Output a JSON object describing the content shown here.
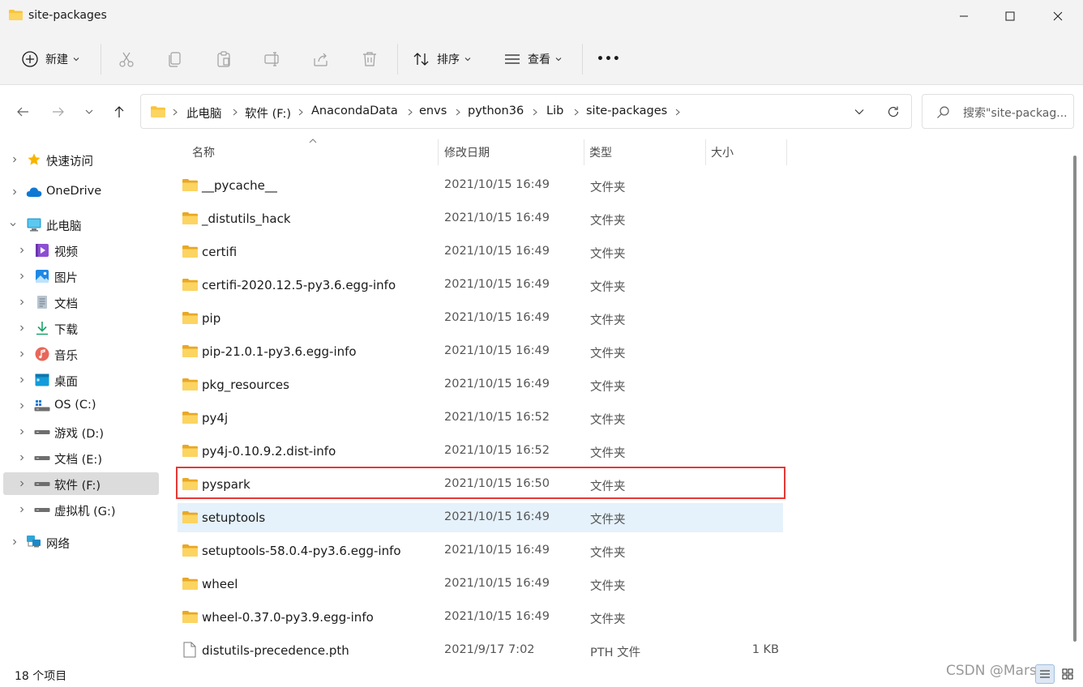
{
  "window": {
    "title": "site-packages"
  },
  "toolbar": {
    "new_label": "新建",
    "sort_label": "排序",
    "view_label": "查看",
    "more_label": "•••"
  },
  "breadcrumb": [
    "此电脑",
    "软件 (F:)",
    "AnacondaData",
    "envs",
    "python36",
    "Lib",
    "site-packages"
  ],
  "search": {
    "placeholder": "搜索\"site-packag..."
  },
  "sidebar": {
    "items": [
      {
        "label": "快速访问",
        "icon": "star-icon"
      },
      {
        "label": "OneDrive",
        "icon": "cloud-icon"
      },
      {
        "label": "此电脑",
        "icon": "computer-icon"
      },
      {
        "label": "视频",
        "icon": "video-icon"
      },
      {
        "label": "图片",
        "icon": "pictures-icon"
      },
      {
        "label": "文档",
        "icon": "documents-icon"
      },
      {
        "label": "下载",
        "icon": "download-icon"
      },
      {
        "label": "音乐",
        "icon": "music-icon"
      },
      {
        "label": "桌面",
        "icon": "desktop-icon"
      },
      {
        "label": "OS (C:)",
        "icon": "windows-drive-icon"
      },
      {
        "label": "游戏  (D:)",
        "icon": "drive-icon"
      },
      {
        "label": "文档 (E:)",
        "icon": "drive-icon"
      },
      {
        "label": "软件 (F:)",
        "icon": "drive-icon"
      },
      {
        "label": "虚拟机 (G:)",
        "icon": "drive-icon"
      },
      {
        "label": "网络",
        "icon": "network-icon"
      }
    ]
  },
  "columns": {
    "name": "名称",
    "date": "修改日期",
    "type": "类型",
    "size": "大小"
  },
  "files": [
    {
      "name": "__pycache__",
      "date": "2021/10/15 16:49",
      "type": "文件夹",
      "size": ""
    },
    {
      "name": "_distutils_hack",
      "date": "2021/10/15 16:49",
      "type": "文件夹",
      "size": ""
    },
    {
      "name": "certifi",
      "date": "2021/10/15 16:49",
      "type": "文件夹",
      "size": ""
    },
    {
      "name": "certifi-2020.12.5-py3.6.egg-info",
      "date": "2021/10/15 16:49",
      "type": "文件夹",
      "size": ""
    },
    {
      "name": "pip",
      "date": "2021/10/15 16:49",
      "type": "文件夹",
      "size": ""
    },
    {
      "name": "pip-21.0.1-py3.6.egg-info",
      "date": "2021/10/15 16:49",
      "type": "文件夹",
      "size": ""
    },
    {
      "name": "pkg_resources",
      "date": "2021/10/15 16:49",
      "type": "文件夹",
      "size": ""
    },
    {
      "name": "py4j",
      "date": "2021/10/15 16:52",
      "type": "文件夹",
      "size": ""
    },
    {
      "name": "py4j-0.10.9.2.dist-info",
      "date": "2021/10/15 16:52",
      "type": "文件夹",
      "size": ""
    },
    {
      "name": "pyspark",
      "date": "2021/10/15 16:50",
      "type": "文件夹",
      "size": ""
    },
    {
      "name": "setuptools",
      "date": "2021/10/15 16:49",
      "type": "文件夹",
      "size": ""
    },
    {
      "name": "setuptools-58.0.4-py3.6.egg-info",
      "date": "2021/10/15 16:49",
      "type": "文件夹",
      "size": ""
    },
    {
      "name": "wheel",
      "date": "2021/10/15 16:49",
      "type": "文件夹",
      "size": ""
    },
    {
      "name": "wheel-0.37.0-py3.9.egg-info",
      "date": "2021/10/15 16:49",
      "type": "文件夹",
      "size": ""
    },
    {
      "name": "distutils-precedence.pth",
      "date": "2021/9/17 7:02",
      "type": "PTH 文件",
      "size": "1 KB"
    }
  ],
  "status": {
    "count": "18 个项目"
  },
  "watermark": "CSDN @Mars",
  "colors": {
    "folder": "#f8c43a",
    "accent": "#005fb8",
    "highlight_border": "#e53935",
    "hover_row": "#e5f1fb"
  }
}
